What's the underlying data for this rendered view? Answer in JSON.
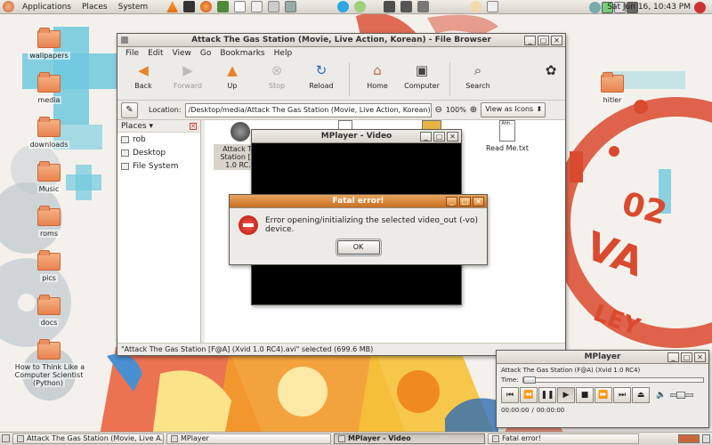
{
  "top_panel": {
    "menus": [
      "Applications",
      "Places",
      "System"
    ],
    "clock": "Sat Jun 16, 10:43 PM"
  },
  "desktop": {
    "icons_left": [
      "wallpapers",
      "media",
      "downloads",
      "Music",
      "roms",
      "pics",
      "docs",
      "How to Think Like a Computer Scientist (Python)"
    ],
    "icon_right": "hitler"
  },
  "file_browser": {
    "title": "Attack The Gas Station (Movie, Live Action, Korean) - File Browser",
    "menus": [
      "File",
      "Edit",
      "View",
      "Go",
      "Bookmarks",
      "Help"
    ],
    "toolbar": {
      "back": "Back",
      "forward": "Forward",
      "up": "Up",
      "stop": "Stop",
      "reload": "Reload",
      "home": "Home",
      "computer": "Computer",
      "search": "Search"
    },
    "location_label": "Location:",
    "location_value": "/Desktop/media/Attack The Gas Station (Movie, Live Action, Korean)",
    "zoom": "100%",
    "view_as": "View as Icons",
    "places_label": "Places",
    "places": [
      "rob",
      "Desktop",
      "File System"
    ],
    "files": {
      "video_name": "Attack T... Station [F... 1.0 RC...",
      "readme": "Read Me.txt"
    },
    "status": "\"Attack The Gas Station [F@A] (Xvid 1.0 RC4).avi\" selected (699.6 MB)"
  },
  "mplayer_video": {
    "title": "MPlayer - Video"
  },
  "fatal_dialog": {
    "title": "Fatal error!",
    "message": "Error opening/initializing the selected video_out (-vo) device.",
    "ok": "OK"
  },
  "mplayer_control": {
    "title": "MPlayer",
    "file": "Attack The Gas Station (F@A) (Xvid 1.0 RC4)",
    "time_label": "Time:",
    "time_current": "00:00:00",
    "time_sep": "/",
    "time_total": "00:00:00",
    "time_progress": 0.0
  },
  "taskbar": {
    "tasks": [
      "Attack The Gas Station (Movie, Live A...",
      "MPlayer",
      "MPlayer - Video",
      "Fatal error!"
    ],
    "active_index": 2
  },
  "colors": {
    "accent_orange": "#c86f22",
    "wallpaper_cyan": "#5ec5dc",
    "wallpaper_red": "#d94a2e"
  }
}
